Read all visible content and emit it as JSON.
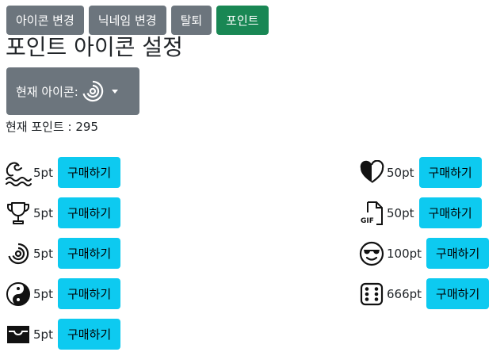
{
  "tabs": [
    {
      "label": "아이콘 변경"
    },
    {
      "label": "닉네임 변경"
    },
    {
      "label": "탈퇴"
    },
    {
      "label": "포인트"
    }
  ],
  "title": "포인트 아이콘 설정",
  "current_icon": {
    "label": "현재 아이콘:",
    "icon": "spiral-icon"
  },
  "points_text": "현재 포인트 : 295",
  "items": [
    {
      "icon": "wave-icon",
      "price": "5pt",
      "button": "구매하기"
    },
    {
      "icon": "trophy-icon",
      "price": "5pt",
      "button": "구매하기"
    },
    {
      "icon": "spiral-icon",
      "price": "5pt",
      "button": "구매하기"
    },
    {
      "icon": "yin-yang-icon",
      "price": "5pt",
      "button": "구매하기"
    },
    {
      "icon": "inbox-icon",
      "price": "5pt",
      "button": "구매하기"
    },
    {
      "icon": "heart-half-icon",
      "price": "50pt",
      "button": "구매하기"
    },
    {
      "icon": "gif-file-icon",
      "price": "50pt",
      "button": "구매하기"
    },
    {
      "icon": "sunglasses-emoji-icon",
      "price": "100pt",
      "button": "구매하기"
    },
    {
      "icon": "dice-six-icon",
      "price": "666pt",
      "button": "구매하기"
    }
  ],
  "colors": {
    "secondary": "#6c757d",
    "success": "#198754",
    "info": "#0dcaf0"
  }
}
